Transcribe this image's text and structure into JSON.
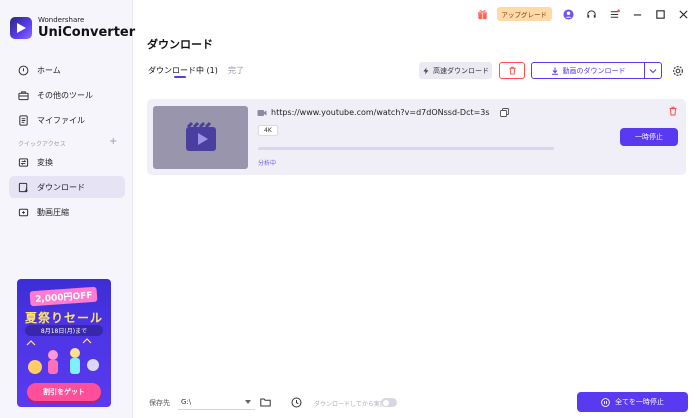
{
  "brand": {
    "small": "Wondershare",
    "big": "UniConverter"
  },
  "sidebar": {
    "items": [
      {
        "label": "ホーム",
        "icon": "home-icon"
      },
      {
        "label": "その他のツール",
        "icon": "toolbox-icon"
      },
      {
        "label": "マイファイル",
        "icon": "file-icon"
      }
    ],
    "quick_access_label": "クイックアクセス",
    "quick_add": "+",
    "quick_items": [
      {
        "label": "変換",
        "icon": "convert-icon"
      },
      {
        "label": "ダウンロード",
        "icon": "download-icon",
        "active": true
      },
      {
        "label": "動画圧縮",
        "icon": "compress-icon"
      }
    ],
    "banner": {
      "discount": "2,000円OFF",
      "title": "夏祭りセール",
      "date": "8月18日(月)まで",
      "button": "割引をゲット"
    }
  },
  "titlebar": {
    "upgrade_label": "アップグレード"
  },
  "main": {
    "title": "ダウンロード",
    "tabs": [
      {
        "label": "ダウンロード中",
        "count": "(1)",
        "active": true
      },
      {
        "label": "完了",
        "active": false
      }
    ],
    "toolbar": {
      "fast_download": "高速ダウンロード",
      "video_download": "動画のダウンロード"
    },
    "task": {
      "url": "https://www.youtube.com/watch?v=d7dONssd-Dct=3s",
      "quality": "4K",
      "progress": 0,
      "status": "分析中",
      "pause_label": "一時停止"
    }
  },
  "bottom": {
    "save_label": "保存先",
    "path": "G:\\",
    "after_download_label": "ダウンロードしてから実施",
    "after_download_enabled": false,
    "pause_all_label": "全てを一時停止"
  },
  "colors": {
    "accent": "#5a3af0",
    "danger": "#ff4d4f",
    "upgrade_bg": "#ffd9a8"
  }
}
